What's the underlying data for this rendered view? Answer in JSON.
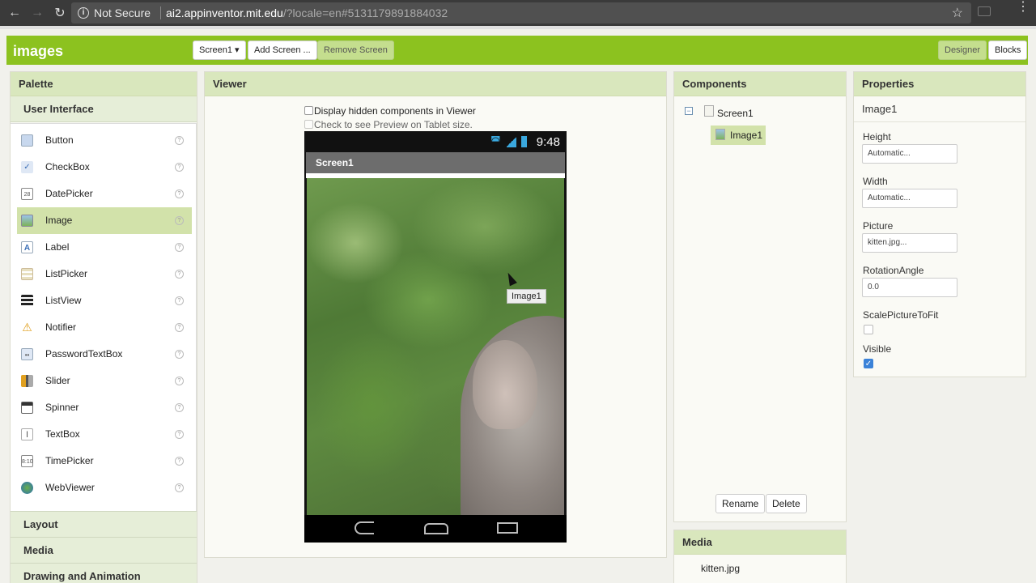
{
  "browser": {
    "security_label": "Not Secure",
    "url_host": "ai2.appinventor.mit.edu",
    "url_path": "/?locale=en#5131179891884032"
  },
  "topbar": {
    "project_name": "images",
    "screen_dropdown": "Screen1",
    "add_screen": "Add Screen ...",
    "remove_screen": "Remove Screen",
    "designer": "Designer",
    "blocks": "Blocks"
  },
  "palette": {
    "title": "Palette",
    "section": "User Interface",
    "items": [
      {
        "label": "Button",
        "icon": "button-icon"
      },
      {
        "label": "CheckBox",
        "icon": "checkbox-icon"
      },
      {
        "label": "DatePicker",
        "icon": "datepicker-icon"
      },
      {
        "label": "Image",
        "icon": "image-icon"
      },
      {
        "label": "Label",
        "icon": "label-icon"
      },
      {
        "label": "ListPicker",
        "icon": "listpicker-icon"
      },
      {
        "label": "ListView",
        "icon": "listview-icon"
      },
      {
        "label": "Notifier",
        "icon": "notifier-icon"
      },
      {
        "label": "PasswordTextBox",
        "icon": "passwordtextbox-icon"
      },
      {
        "label": "Slider",
        "icon": "slider-icon"
      },
      {
        "label": "Spinner",
        "icon": "spinner-icon"
      },
      {
        "label": "TextBox",
        "icon": "textbox-icon"
      },
      {
        "label": "TimePicker",
        "icon": "timepicker-icon"
      },
      {
        "label": "WebViewer",
        "icon": "webviewer-icon"
      }
    ],
    "help_glyph": "?",
    "categories": [
      "Layout",
      "Media",
      "Drawing and Animation"
    ]
  },
  "viewer": {
    "title": "Viewer",
    "display_hidden": "Display hidden components in Viewer",
    "tablet_preview": "Check to see Preview on Tablet size.",
    "clock": "9:48",
    "screen_title": "Screen1",
    "tooltip": "Image1"
  },
  "components": {
    "title": "Components",
    "root": "Screen1",
    "child": "Image1",
    "rename": "Rename",
    "delete": "Delete"
  },
  "media": {
    "title": "Media",
    "files": [
      "kitten.jpg"
    ]
  },
  "properties": {
    "title": "Properties",
    "component": "Image1",
    "height_label": "Height",
    "height_value": "Automatic...",
    "width_label": "Width",
    "width_value": "Automatic...",
    "picture_label": "Picture",
    "picture_value": "kitten.jpg...",
    "rotation_label": "RotationAngle",
    "rotation_value": "0.0",
    "scale_label": "ScalePictureToFit",
    "scale_checked": false,
    "visible_label": "Visible",
    "visible_checked": true
  },
  "colors": {
    "brand_green": "#8cc21f",
    "panel_header": "#d9e7bd",
    "selection": "#d2e2aa"
  }
}
